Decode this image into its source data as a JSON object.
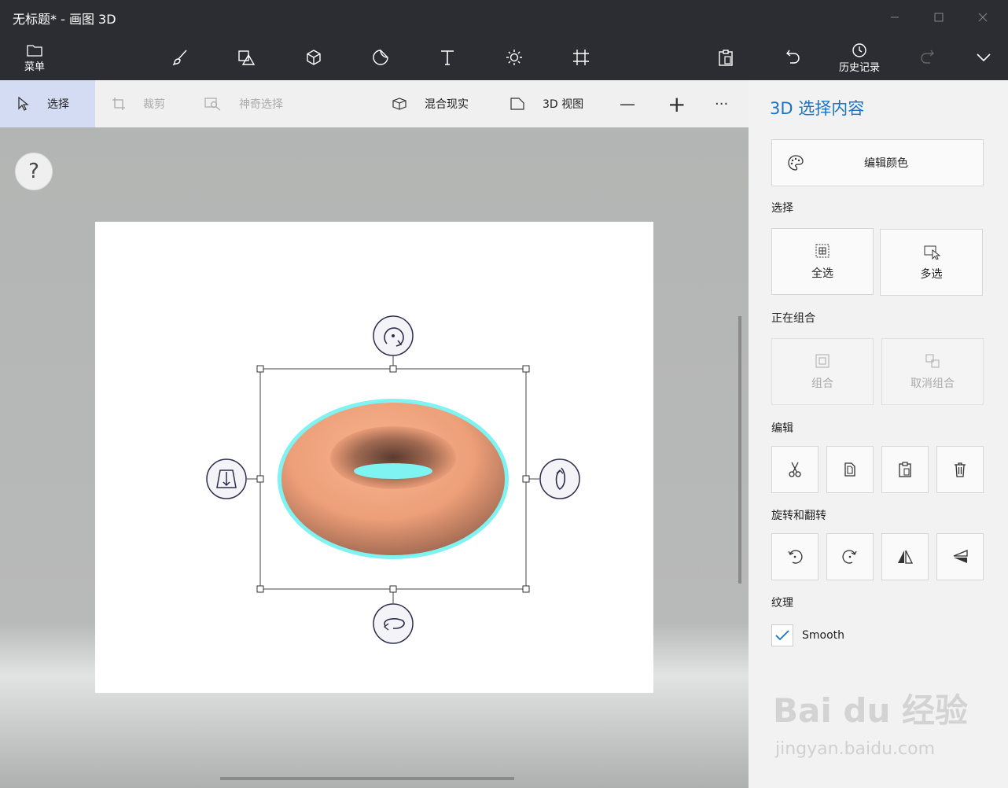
{
  "window": {
    "title": "无标题* - 画图 3D"
  },
  "toolbar": {
    "menu_label": "菜单",
    "history_label": "历史记录",
    "icons": [
      "brush-icon",
      "2d-shapes-icon",
      "3d-shapes-icon",
      "stickers-icon",
      "text-icon",
      "effects-icon",
      "canvas-icon",
      "paste-icon",
      "undo-icon",
      "history-icon",
      "redo-icon",
      "expand-icon"
    ]
  },
  "subbar": {
    "select_label": "选择",
    "crop_label": "裁剪",
    "magic_select_label": "神奇选择",
    "mixed_reality_label": "混合现实",
    "view3d_label": "3D 视图",
    "zoom_out_label": "—",
    "zoom_in_label": "+",
    "more_label": "···"
  },
  "canvas": {
    "help_label": "?",
    "object_color": "#f0a47f",
    "selection_glow": "#7ff2f2"
  },
  "panel": {
    "title": "3D 选择内容",
    "edit_color_label": "编辑颜色",
    "select_section": "选择",
    "select_all_label": "全选",
    "multi_select_label": "多选",
    "group_section": "正在组合",
    "group_label": "组合",
    "ungroup_label": "取消组合",
    "edit_section": "编辑",
    "rotate_section": "旋转和翻转",
    "texture_section": "纹理",
    "smooth_label": "Smooth",
    "smooth_checked": true
  },
  "watermark": {
    "line1": "Bai du 经验",
    "line2": "jingyan.baidu.com"
  },
  "colors": {
    "accent": "#1a73c4",
    "titlebar": "#2b2d33",
    "active_tool": "#d4dcf3"
  }
}
